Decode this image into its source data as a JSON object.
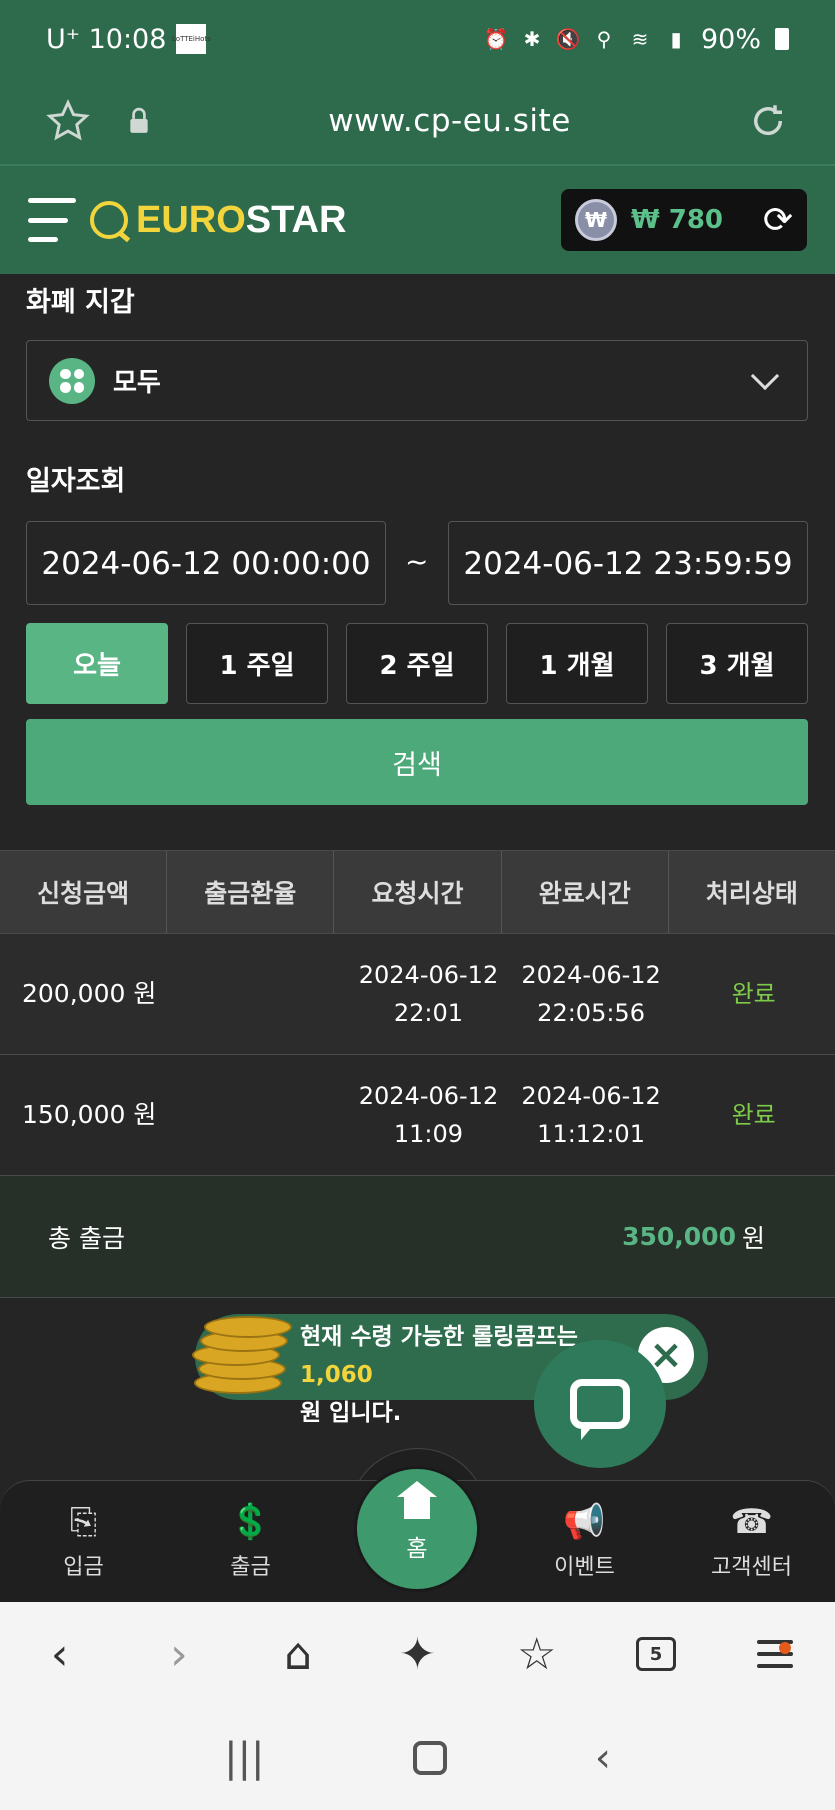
{
  "status_bar": {
    "carrier_time": "U⁺ 10:08",
    "thumb_label": "LoTTEiHots",
    "battery": "90%"
  },
  "browser": {
    "url": "www.cp-eu.site"
  },
  "header": {
    "logo_a": "EURO",
    "logo_b": "STAR",
    "currency_symbol": "₩",
    "balance": "₩ 780"
  },
  "wallet": {
    "label": "화폐 지갑",
    "selected": "모두"
  },
  "date_search": {
    "label": "일자조회",
    "from": "2024-06-12 00:00:00",
    "separator": "~",
    "to": "2024-06-12 23:59:59",
    "periods": [
      "오늘",
      "1 주일",
      "2 주일",
      "1 개월",
      "3 개월"
    ],
    "active_period": "오늘",
    "search_label": "검색"
  },
  "table": {
    "headers": [
      "신청금액",
      "출금환율",
      "요청시간",
      "완료시간",
      "처리상태"
    ],
    "rows": [
      {
        "amount": "200,000 원",
        "rate": "",
        "request_date": "2024-06-12",
        "request_time": "22:01",
        "complete_date": "2024-06-12",
        "complete_time": "22:05:56",
        "status": "완료"
      },
      {
        "amount": "150,000 원",
        "rate": "",
        "request_date": "2024-06-12",
        "request_time": "11:09",
        "complete_date": "2024-06-12",
        "complete_time": "11:12:01",
        "status": "완료"
      }
    ],
    "total_label": "총 출금",
    "total_value": "350,000",
    "total_unit": "원"
  },
  "promo": {
    "text_before": "현재 수령 가능한 롤링콤프는 ",
    "highlight": "1,060",
    "text_after": "원 입니다."
  },
  "bottom_nav": {
    "deposit": "입금",
    "withdraw": "출금",
    "home": "홈",
    "event": "이벤트",
    "support": "고객센터"
  },
  "browser_toolbar": {
    "tabs_count": "5"
  },
  "colors": {
    "brand_green": "#2e6b4d",
    "accent_green": "#5ab585",
    "status_done": "#7ecb4a",
    "logo_yellow": "#f2d53c"
  }
}
